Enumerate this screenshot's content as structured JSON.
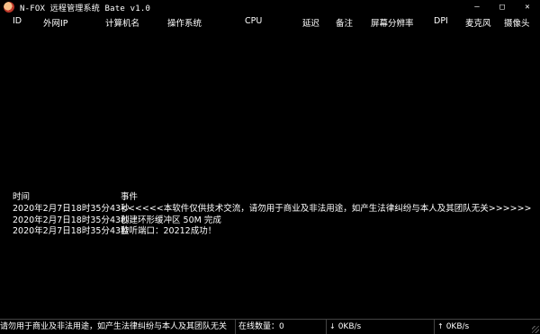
{
  "window": {
    "title": "N-FOX 远程管理系统 Bate v1.0",
    "controls": [
      "—",
      "□",
      "✕"
    ]
  },
  "host_list": {
    "columns": [
      "ID",
      "外网IP",
      "计算机名",
      "操作系统",
      "CPU",
      "延迟",
      "备注",
      "屏幕分辨率",
      "DPI",
      "麦克风",
      "摄像头"
    ],
    "rows": []
  },
  "log": {
    "columns": [
      "时间",
      "事件"
    ],
    "rows": [
      {
        "time": "2020年2月7日18时35分43秒",
        "event": "<<<<<<本软件仅供技术交流，请勿用于商业及非法用途，如产生法律纠纷与本人及其团队无关>>>>>>"
      },
      {
        "time": "2020年2月7日18时35分43秒",
        "event": "创建环形缓冲区 50M 完成"
      },
      {
        "time": "2020年2月7日18时35分43秒",
        "event": "监听端口：20212成功！"
      }
    ]
  },
  "statusbar": {
    "notice": "请勿用于商业及非法用途，如产生法律纠纷与本人及其团队无关",
    "online_label": "在线数量：0",
    "down_speed": "0KB/s",
    "up_speed": "0KB/s",
    "down_icon": "arrow-down-icon",
    "up_icon": "arrow-up-icon"
  },
  "colors": {
    "background": "#000000",
    "text": "#ffffff",
    "border": "#444444"
  }
}
